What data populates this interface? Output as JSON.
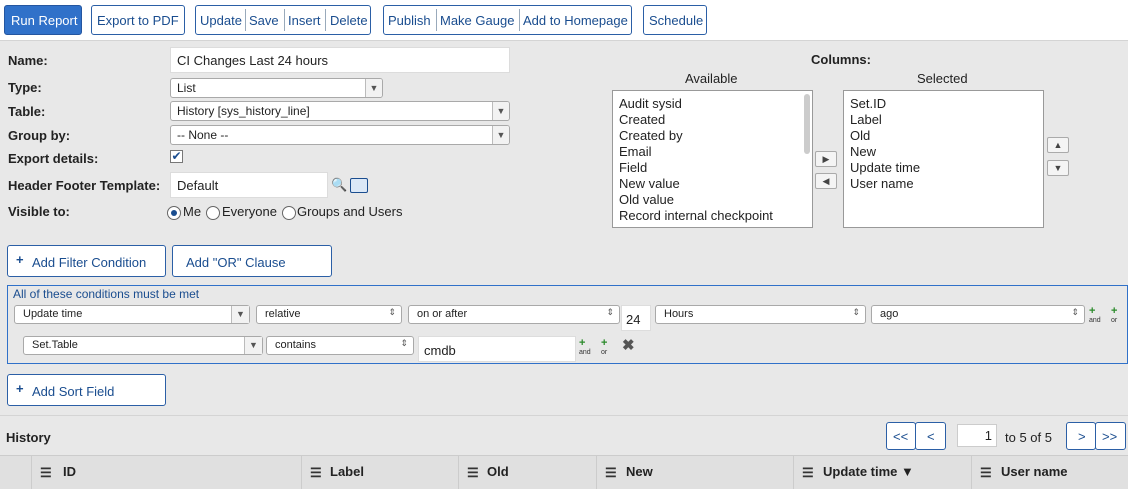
{
  "toolbar": {
    "run_report": "Run Report",
    "export_pdf": "Export to PDF",
    "update": "Update",
    "save": "Save",
    "insert": "Insert",
    "delete": "Delete",
    "publish": "Publish",
    "make_gauge": "Make Gauge",
    "add_homepage": "Add to Homepage",
    "schedule": "Schedule"
  },
  "form": {
    "name_label": "Name:",
    "name_value": "CI Changes Last 24 hours",
    "type_label": "Type:",
    "type_value": "List",
    "table_label": "Table:",
    "table_value": "History [sys_history_line]",
    "groupby_label": "Group by:",
    "groupby_value": "-- None --",
    "export_label": "Export details:",
    "export_checked": true,
    "header_label": "Header Footer Template:",
    "header_value": "Default",
    "visible_label": "Visible to:",
    "visible_options": [
      "Me",
      "Everyone",
      "Groups and Users"
    ],
    "visible_selected": "Me"
  },
  "columns": {
    "title": "Columns:",
    "available_label": "Available",
    "selected_label": "Selected",
    "available": [
      "Audit sysid",
      "Created",
      "Created by",
      "Email",
      "Field",
      "New value",
      "Old value",
      "Record internal checkpoint"
    ],
    "selected": [
      "Set.ID",
      "Label",
      "Old",
      "New",
      "Update time",
      "User name"
    ]
  },
  "filter": {
    "add_condition": "Add Filter Condition",
    "add_or": "Add \"OR\" Clause",
    "heading": "All of these conditions must be met",
    "row1": {
      "field": "Update time",
      "mode": "relative",
      "op": "on or after",
      "value": "24",
      "unit": "Hours",
      "dir": "ago"
    },
    "row2": {
      "field": "Set.Table",
      "op": "contains",
      "value": "cmdb"
    },
    "and_label": "and",
    "or_label": "or",
    "add_sort": "Add Sort Field"
  },
  "history": {
    "title": "History",
    "first": "<<",
    "prev": "<",
    "page_value": "1",
    "page_text": "to 5 of 5",
    "next": ">",
    "last": ">>",
    "columns": [
      "ID",
      "Label",
      "Old",
      "New",
      "Update time ▼",
      "User name"
    ]
  },
  "colors": {
    "accent": "#3071c9",
    "border_blue": "#2b5fa6",
    "link": "#1a4d8f"
  }
}
